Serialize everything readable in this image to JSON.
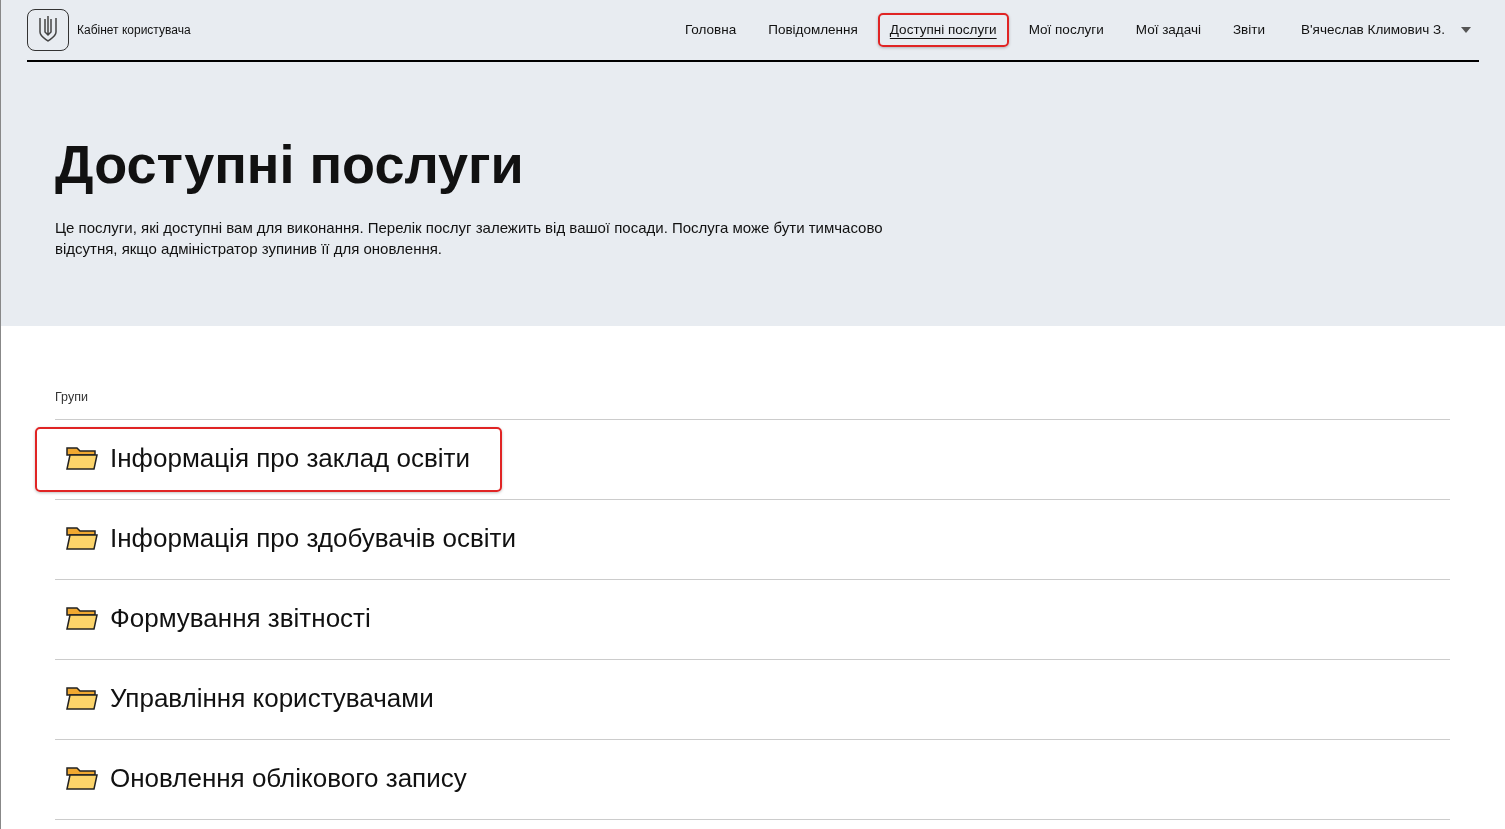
{
  "header": {
    "brand": "Кабінет користувача",
    "nav": [
      {
        "label": "Головна",
        "selected": false,
        "highlighted": false
      },
      {
        "label": "Повідомлення",
        "selected": false,
        "highlighted": false
      },
      {
        "label": "Доступні послуги",
        "selected": true,
        "highlighted": true
      },
      {
        "label": "Мої послуги",
        "selected": false,
        "highlighted": false
      },
      {
        "label": "Мої задачі",
        "selected": false,
        "highlighted": false
      },
      {
        "label": "Звіти",
        "selected": false,
        "highlighted": false
      }
    ],
    "user": "В'ячеслав Климович З."
  },
  "hero": {
    "title": "Доступні послуги",
    "description": "Це послуги, які доступні вам для виконання. Перелік послуг залежить від вашої посади. Послуга може бути тимчасово відсутня, якщо адміністратор зупинив її для оновлення."
  },
  "groups": {
    "label": "Групи",
    "items": [
      {
        "name": "Інформація про заклад освіти",
        "highlighted": true
      },
      {
        "name": "Інформація про здобувачів освіти",
        "highlighted": false
      },
      {
        "name": "Формування звітності",
        "highlighted": false
      },
      {
        "name": "Управління користувачами",
        "highlighted": false
      },
      {
        "name": "Оновлення облікового запису",
        "highlighted": false
      }
    ]
  }
}
